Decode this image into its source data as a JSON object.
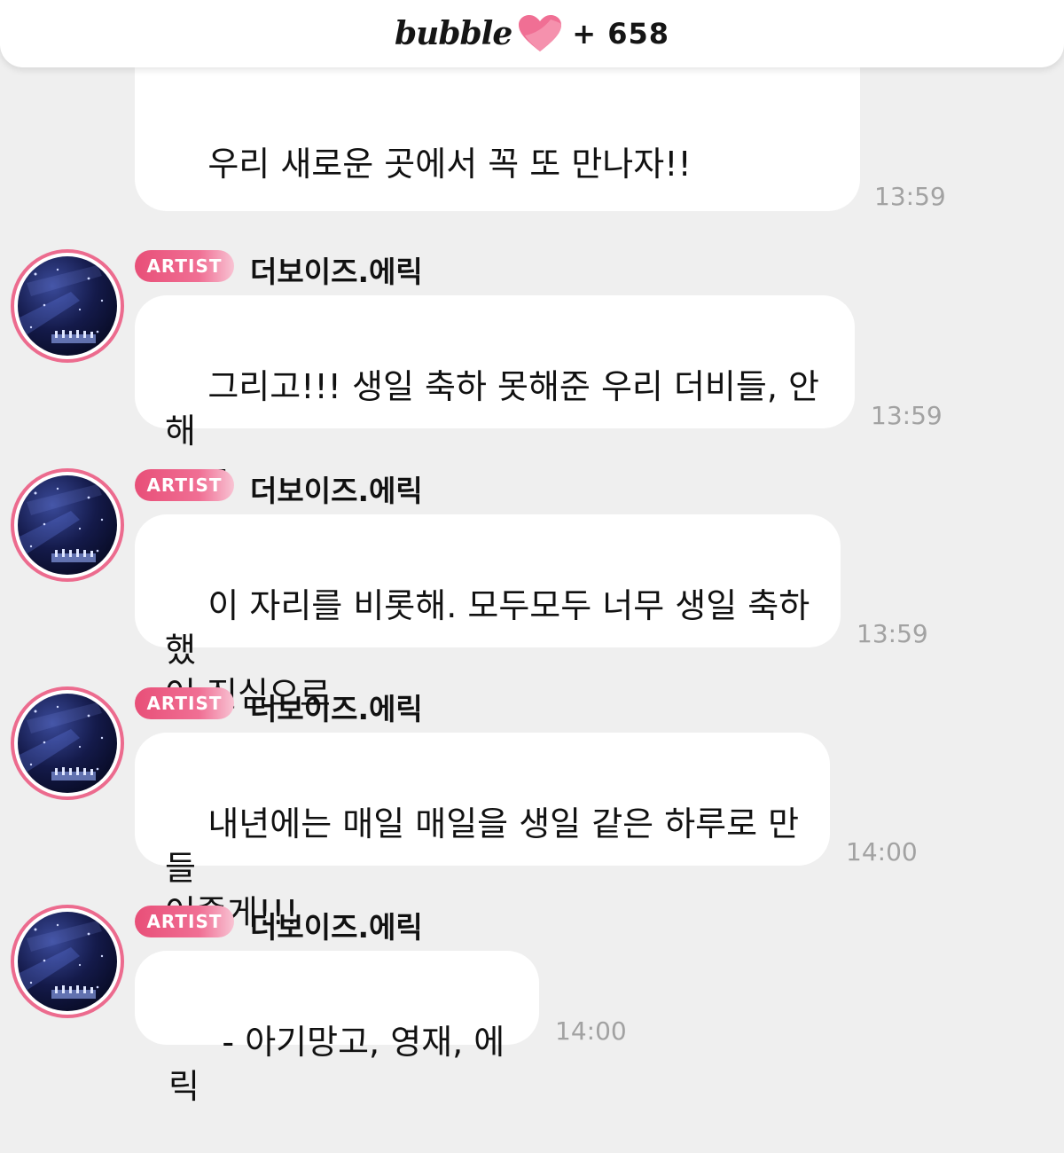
{
  "header": {
    "brand": "bubble",
    "count": "+ 658",
    "heart_color": "#f06f94"
  },
  "messages": [
    {
      "text": "우리 새로운 곳에서 꼭 또 만나자!!",
      "time": "13:59"
    },
    {
      "badge": "ARTIST",
      "sender": "더보이즈.에릭",
      "text": "그리고!!! 생일 축하 못해준 우리 더비들, 안해\nㅜㅜ",
      "time": "13:59"
    },
    {
      "badge": "ARTIST",
      "sender": "더보이즈.에릭",
      "text": "이 자리를 비롯해. 모두모두 너무 생일 축하했\n어 진심으로",
      "time": "13:59"
    },
    {
      "badge": "ARTIST",
      "sender": "더보이즈.에릭",
      "text": "내년에는 매일 매일을 생일 같은 하루로 만들\n어줄게!!!",
      "time": "14:00"
    },
    {
      "badge": "ARTIST",
      "sender": "더보이즈.에릭",
      "text": " - 아기망고, 영재, 에릭",
      "time": "14:00"
    }
  ],
  "colors": {
    "accent_pink": "#ec6b8e",
    "background": "#efefef",
    "bubble": "#ffffff",
    "timestamp": "#a2a2a2"
  },
  "icons": {
    "heart": "heart-icon",
    "avatar": "avatar-photo"
  }
}
